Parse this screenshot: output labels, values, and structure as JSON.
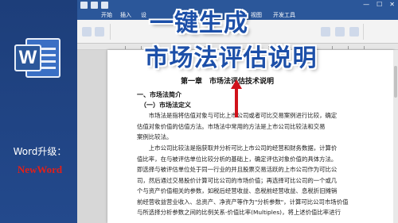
{
  "promo": {
    "line1": "Word升级：",
    "line2": "NewWord",
    "logo_letter": "W"
  },
  "overlay": {
    "line1": "一键生成",
    "line2": "市场法评估说明"
  },
  "ribbon_tabs": {
    "file": "",
    "home": "开始",
    "insert": "插入",
    "design": "设",
    "view": "视图",
    "developer": "开发工具"
  },
  "document": {
    "title": "第一章　市场法评估技术说明",
    "heading1": "一、市场法简介",
    "heading2": "（一）市场法定义",
    "para1": [
      "　　市场法是指将估值对象与可比上市公司或者可比交易案例进行比较，确定",
      "估值对象价值的估值方法。市场法中常用的方法是上市公司比较法和交易",
      "案例比较法。"
    ],
    "para2": [
      "　　上市公司比较法是指获取并分析可比上市公司的经营和财务数据，计算价",
      "值比率，在与被评估单位比较分析的基础上，确定评估对象价值的具体方法。",
      "即选择与被评估单位处于同一行业的并且股票交易活跃的上市公司作为可比公",
      "司，然后通过交易股价计算可比公司的市场价值；再选择可比公司的一个或几",
      "个与资产价值相关的参数，如税后经营收益、息税前经营收益、息税折旧摊销",
      "前经营收益营业收入、总资产、净资产等作为\"分析参数\"，计算可比公司市场价值",
      "与所选择分析参数之间的比例关系-价值比率(Multiples)，将上述价值比率进行"
    ]
  },
  "colors": {
    "brand_blue": "#2b579a",
    "overlay_text": "#1c4fa8",
    "promo_red": "#e0201a",
    "arrow_red": "#d0121b"
  }
}
